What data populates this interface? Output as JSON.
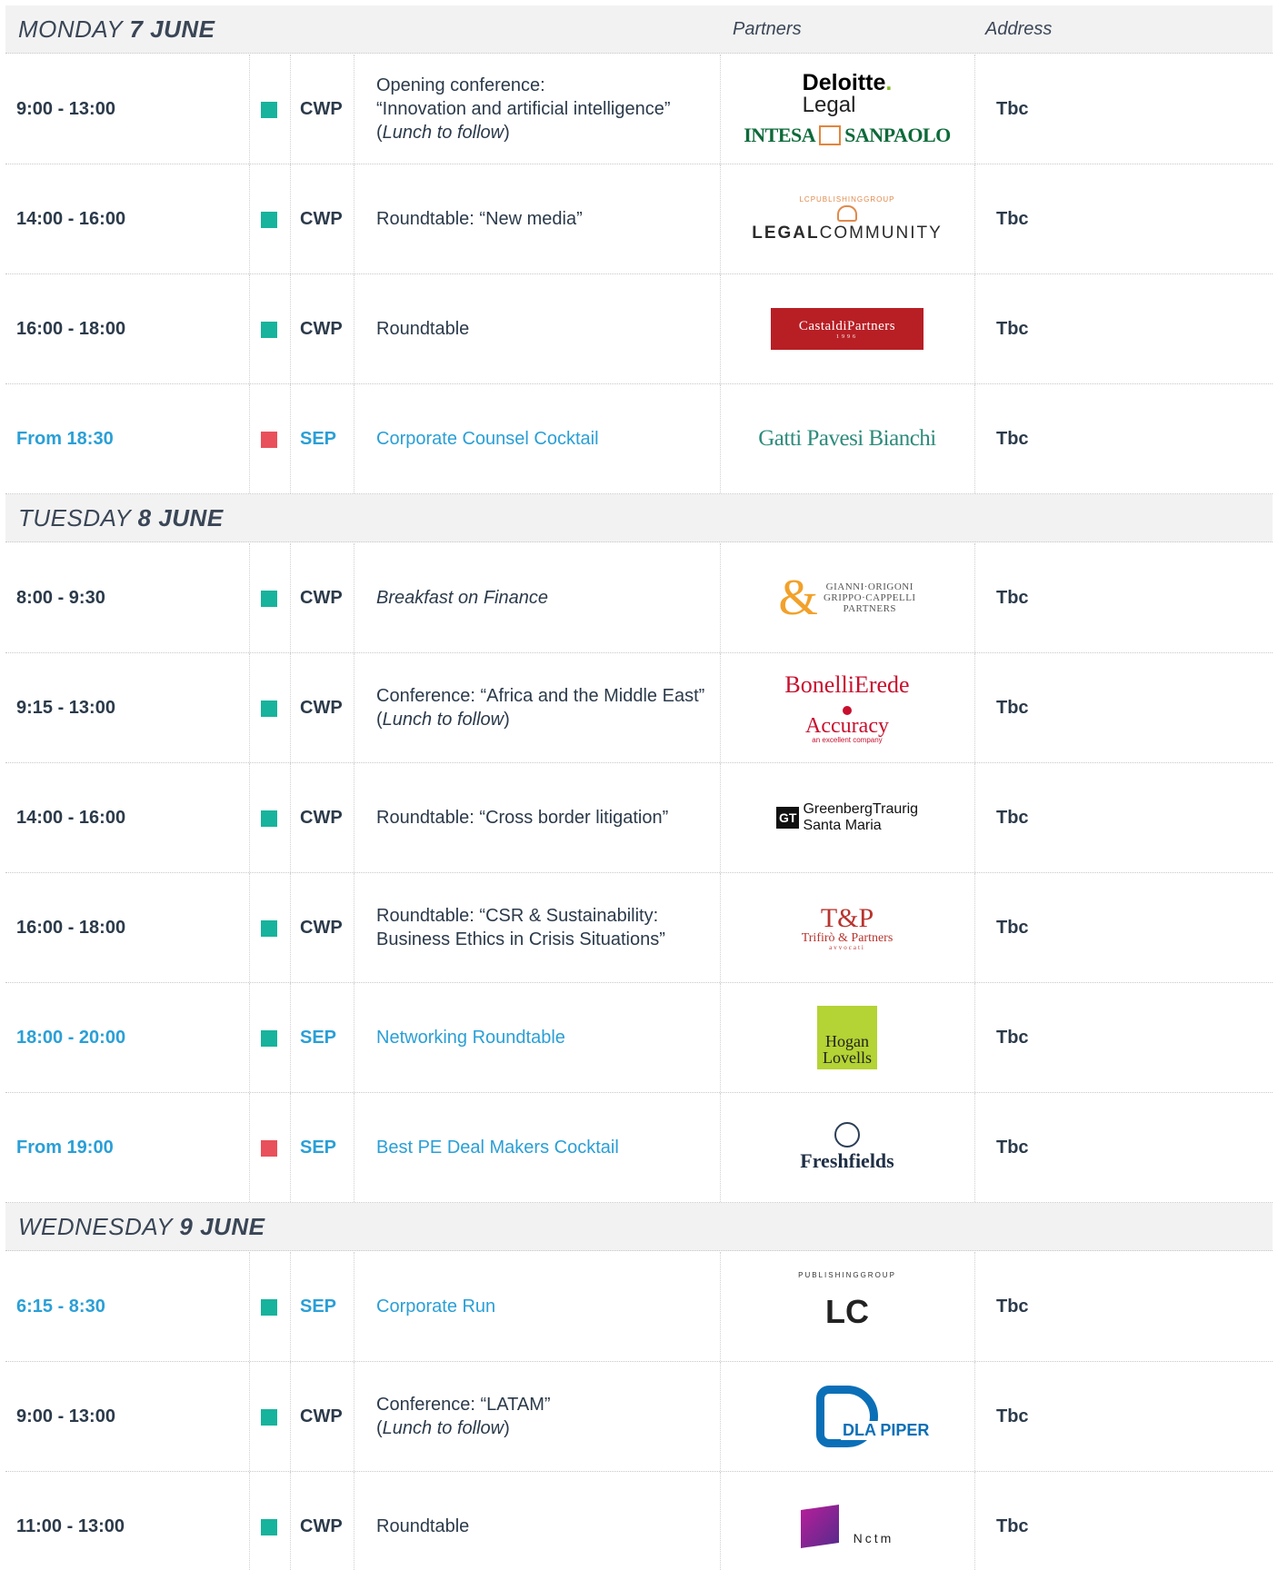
{
  "columns": {
    "partners": "Partners",
    "address": "Address"
  },
  "colors": {
    "green": "#17b39c",
    "red": "#e8505b",
    "highlight": "#2a9fd6"
  },
  "days": [
    {
      "day_prefix": "MONDAY",
      "day_bold": "7 JUNE",
      "rows": [
        {
          "time": "9:00 - 13:00",
          "color": "green",
          "code": "CWP",
          "lines": [
            "Opening conference:",
            "“Innovation and artificial intelligence”"
          ],
          "lunch": true,
          "partners": [
            "deloitte",
            "intesa"
          ],
          "address": "Tbc",
          "hl": false
        },
        {
          "time": "14:00 - 16:00",
          "color": "green",
          "code": "CWP",
          "lines": [
            "Roundtable: “New media”"
          ],
          "lunch": false,
          "partners": [
            "legalcommunity"
          ],
          "address": "Tbc",
          "hl": false
        },
        {
          "time": "16:00 - 18:00",
          "color": "green",
          "code": "CWP",
          "lines": [
            "Roundtable"
          ],
          "lunch": false,
          "partners": [
            "castaldi"
          ],
          "address": "Tbc",
          "hl": false
        },
        {
          "time": "From 18:30",
          "color": "red",
          "code": "SEP",
          "lines": [
            "Corporate Counsel Cocktail"
          ],
          "lunch": false,
          "partners": [
            "gatti"
          ],
          "address": "Tbc",
          "hl": true
        }
      ]
    },
    {
      "day_prefix": "TUESDAY",
      "day_bold": "8 JUNE",
      "rows": [
        {
          "time": "8:00 - 9:30",
          "color": "green",
          "code": "CWP",
          "lines": [],
          "italic_line": "Breakfast on Finance",
          "lunch": false,
          "partners": [
            "gianni"
          ],
          "address": "Tbc",
          "hl": false
        },
        {
          "time": "9:15 - 13:00",
          "color": "green",
          "code": "CWP",
          "lines": [
            "Conference: “Africa and the Middle East”"
          ],
          "lunch": true,
          "partners": [
            "bonelli",
            "accuracy"
          ],
          "address": "Tbc",
          "hl": false
        },
        {
          "time": "14:00 - 16:00",
          "color": "green",
          "code": "CWP",
          "lines": [
            "Roundtable: “Cross border litigation”"
          ],
          "lunch": false,
          "partners": [
            "greenberg"
          ],
          "address": "Tbc",
          "hl": false
        },
        {
          "time": "16:00 - 18:00",
          "color": "green",
          "code": "CWP",
          "lines": [
            "Roundtable: “CSR & Sustainability:",
            "Business Ethics in Crisis Situations”"
          ],
          "lunch": false,
          "partners": [
            "trifiro"
          ],
          "address": "Tbc",
          "hl": false
        },
        {
          "time": "18:00 - 20:00",
          "color": "green",
          "code": "SEP",
          "lines": [
            "Networking Roundtable"
          ],
          "lunch": false,
          "partners": [
            "hogan"
          ],
          "address": "Tbc",
          "hl": true
        },
        {
          "time": "From 19:00",
          "color": "red",
          "code": "SEP",
          "lines": [
            "Best PE Deal Makers Cocktail"
          ],
          "lunch": false,
          "partners": [
            "freshfields"
          ],
          "address": "Tbc",
          "hl": true
        }
      ]
    },
    {
      "day_prefix": "WEDNESDAY",
      "day_bold": "9 JUNE",
      "rows": [
        {
          "time": "6:15 - 8:30",
          "color": "green",
          "code": "SEP",
          "lines": [
            "Corporate Run"
          ],
          "lunch": false,
          "partners": [
            "lcpub"
          ],
          "address": "Tbc",
          "hl": true
        },
        {
          "time": "9:00 - 13:00",
          "color": "green",
          "code": "CWP",
          "lines": [
            "Conference: “LATAM”"
          ],
          "lunch": true,
          "partners": [
            "dla"
          ],
          "address": "Tbc",
          "hl": false
        },
        {
          "time": "11:00 - 13:00",
          "color": "green",
          "code": "CWP",
          "lines": [
            "Roundtable"
          ],
          "lunch": false,
          "partners": [
            "nctm"
          ],
          "address": "Tbc",
          "hl": false
        }
      ]
    }
  ],
  "lunch_text": {
    "open": "(",
    "italic": "Lunch to follow",
    "close": ")"
  },
  "logos": {
    "deloitte": {
      "name": "Deloitte",
      "dot": ".",
      "sub": "Legal"
    },
    "intesa": {
      "left": "INTESA",
      "right": "SANPAOLO"
    },
    "legalcommunity": {
      "top": "LCPUBLISHINGGROUP",
      "bold": "LEGAL",
      "rest": "COMMUNITY"
    },
    "castaldi": {
      "name": "CastaldiPartners",
      "year": "1996"
    },
    "gatti": {
      "name": "Gatti Pavesi Bianchi"
    },
    "gianni": {
      "l1": "GIANNI·ORIGONI",
      "l2": "GRIPPO·CAPPELLI",
      "l3": "PARTNERS"
    },
    "bonelli": {
      "name": "BonelliErede"
    },
    "accuracy": {
      "name": "Accuracy",
      "sub": "an excellent company"
    },
    "greenberg": {
      "gt": "GT",
      "l1": "GreenbergTraurig",
      "l2": "Santa Maria"
    },
    "trifiro": {
      "mono": "T&P",
      "name": "Trifirò & Partners",
      "sub": "avvocati"
    },
    "hogan": {
      "l1": "Hogan",
      "l2": "Lovells"
    },
    "freshfields": {
      "name": "Freshfields"
    },
    "lcpub": {
      "ring": "PUBLISHINGGROUP",
      "mono": "LC"
    },
    "dla": {
      "name": "DLA PIPER"
    },
    "nctm": {
      "name": "Nctm"
    }
  }
}
